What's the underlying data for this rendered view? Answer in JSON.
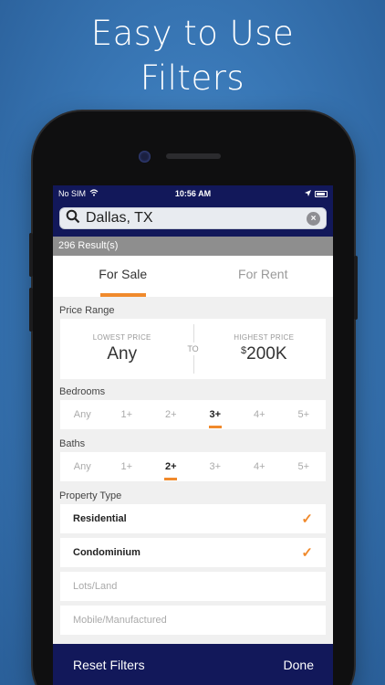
{
  "headline": {
    "line1": "Easy to Use",
    "line2": "Filters"
  },
  "status_bar": {
    "carrier": "No SIM",
    "time": "10:56 AM"
  },
  "search": {
    "value": "Dallas, TX"
  },
  "results": {
    "label": "296 Result(s)"
  },
  "tabs": [
    {
      "label": "For Sale",
      "active": true
    },
    {
      "label": "For Rent",
      "active": false
    }
  ],
  "price_range": {
    "label": "Price Range",
    "lowest_caption": "LOWEST PRICE",
    "lowest_value": "Any",
    "to_label": "TO",
    "highest_caption": "HIGHEST PRICE",
    "highest_currency": "$",
    "highest_value": "200K"
  },
  "bedrooms": {
    "label": "Bedrooms",
    "options": [
      "Any",
      "1+",
      "2+",
      "3+",
      "4+",
      "5+"
    ],
    "selected": "3+"
  },
  "baths": {
    "label": "Baths",
    "options": [
      "Any",
      "1+",
      "2+",
      "3+",
      "4+",
      "5+"
    ],
    "selected": "2+"
  },
  "property_type": {
    "label": "Property Type",
    "items": [
      {
        "label": "Residential",
        "checked": true
      },
      {
        "label": "Condominium",
        "checked": true
      },
      {
        "label": "Lots/Land",
        "checked": false
      },
      {
        "label": "Mobile/Manufactured",
        "checked": false
      }
    ]
  },
  "footer": {
    "reset_label": "Reset Filters",
    "done_label": "Done"
  },
  "colors": {
    "accent": "#f08a2c",
    "nav": "#12185a"
  }
}
